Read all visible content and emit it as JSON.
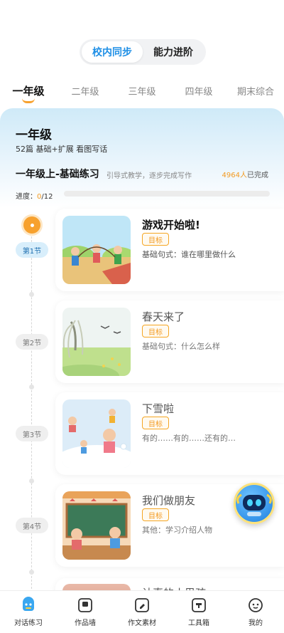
{
  "segment": {
    "tabs": [
      {
        "label": "校内同步",
        "active": true
      },
      {
        "label": "能力进阶",
        "active": false
      }
    ]
  },
  "grades": [
    {
      "label": "一年级",
      "active": true
    },
    {
      "label": "二年级",
      "active": false
    },
    {
      "label": "三年级",
      "active": false
    },
    {
      "label": "四年级",
      "active": false
    },
    {
      "label": "期末综合",
      "active": false
    }
  ],
  "header": {
    "title": "一年级",
    "subtitle": "52篇 基础+扩展 看图写话"
  },
  "section": {
    "title": "一年级上-基础练习",
    "desc": "引导式教学，逐步完成写作",
    "completed_count": "4964人",
    "completed_suffix": "已完成"
  },
  "progress": {
    "label": "进度：",
    "current": "0",
    "total": "/12",
    "fraction": 0.0
  },
  "lessons": [
    {
      "badge": "第1节",
      "title": "游戏开始啦!",
      "tag": "目标",
      "desc": "基础句式：谁在哪里做什么"
    },
    {
      "badge": "第2节",
      "title": "春天来了",
      "tag": "目标",
      "desc": "基础句式：什么怎么样"
    },
    {
      "badge": "第3节",
      "title": "下雪啦",
      "tag": "目标",
      "desc": "有的……有的……还有的…"
    },
    {
      "badge": "第4节",
      "title": "我们做朋友",
      "tag": "目标",
      "desc": "其他：学习介绍人物"
    }
  ],
  "peek_lesson": {
    "title": "认真的小男孩"
  },
  "bottom_nav": [
    {
      "label": "对话练习",
      "icon": "chat-bot-icon",
      "active": true
    },
    {
      "label": "作品墙",
      "icon": "gallery-icon",
      "active": false
    },
    {
      "label": "作文素材",
      "icon": "pencil-note-icon",
      "active": false
    },
    {
      "label": "工具箱",
      "icon": "toolbox-icon",
      "active": false
    },
    {
      "label": "我的",
      "icon": "profile-icon",
      "active": false
    }
  ],
  "colors": {
    "accent_blue": "#1e8fe6",
    "accent_orange": "#f39a21"
  }
}
